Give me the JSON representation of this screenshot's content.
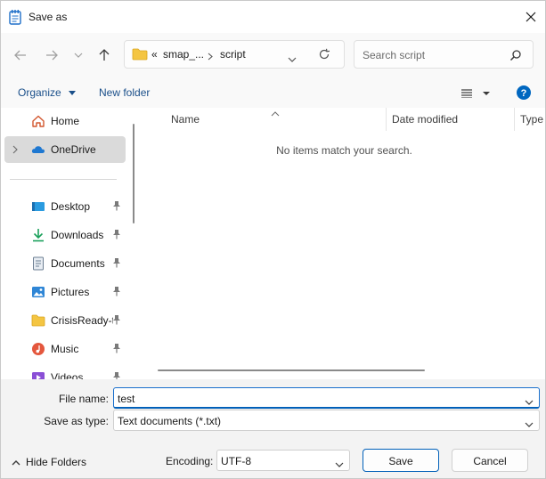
{
  "window": {
    "title": "Save as"
  },
  "address_bar": {
    "overflow_marker": "«",
    "crumbs": [
      "smap_...",
      "script"
    ]
  },
  "search": {
    "placeholder": "Search script"
  },
  "toolbar": {
    "organize_label": "Organize",
    "new_folder_label": "New folder"
  },
  "sidebar": {
    "items": [
      {
        "label": "Home",
        "icon": "home-icon",
        "pinned": false
      },
      {
        "label": "OneDrive",
        "icon": "cloud-icon",
        "pinned": false,
        "selected": true,
        "expandable": true
      },
      {
        "label": "Desktop",
        "icon": "desktop-icon",
        "pinned": true
      },
      {
        "label": "Downloads",
        "icon": "download-icon",
        "pinned": true
      },
      {
        "label": "Documents",
        "icon": "document-icon",
        "pinned": true
      },
      {
        "label": "Pictures",
        "icon": "pictures-icon",
        "pinned": true
      },
      {
        "label": "CrisisReady-t",
        "icon": "folder-icon",
        "pinned": true
      },
      {
        "label": "Music",
        "icon": "music-icon",
        "pinned": true
      },
      {
        "label": "Videos",
        "icon": "videos-icon",
        "pinned": true
      }
    ]
  },
  "filelist": {
    "columns": [
      "Name",
      "Date modified",
      "Type"
    ],
    "empty_message": "No items match your search."
  },
  "form": {
    "file_name_label": "File name:",
    "file_name_value": "test",
    "save_as_type_label": "Save as type:",
    "save_as_type_value": "Text documents (*.txt)"
  },
  "footer": {
    "hide_folders_label": "Hide Folders",
    "encoding_label": "Encoding:",
    "encoding_value": "UTF-8",
    "save_label": "Save",
    "cancel_label": "Cancel"
  },
  "colors": {
    "accent": "#005fb8",
    "link": "#1a4f8a",
    "help": "#0067c0"
  }
}
